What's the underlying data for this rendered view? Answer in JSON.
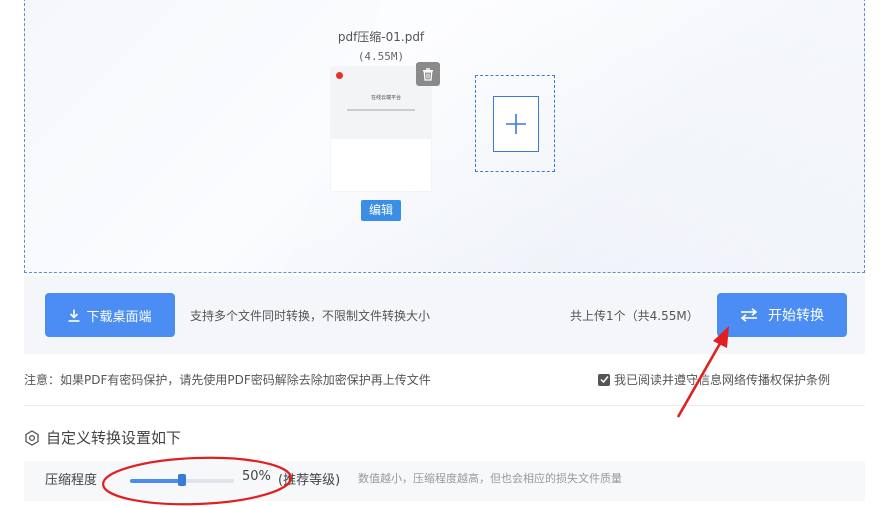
{
  "file": {
    "name": "pdf压缩-01.pdf",
    "size": "(4.55M)",
    "preview_title": "在线云端平台",
    "edit_label": "编辑"
  },
  "toolbar": {
    "download_label": "下载桌面端",
    "support_text": "支持多个文件同时转换，不限制文件转换大小",
    "upload_count": "共上传1个（共4.55M）",
    "start_label": "开始转换"
  },
  "notice": {
    "text": "注意：如果PDF有密码保护，请先使用PDF密码解除去除加密保护再上传文件",
    "agree_text": "我已阅读并遵守信息网络传播权保护条例",
    "agree_checked": true
  },
  "settings": {
    "title": "自定义转换设置如下",
    "compress_label": "压缩程度",
    "compress_percent": 50,
    "compress_value": "50%",
    "level_label": "(推荐等级)",
    "hint": "数值越小，压缩程度越高，但也会相应的损失文件质量"
  },
  "icons": {
    "delete": "trash-icon",
    "add": "plus-icon",
    "download": "download-icon",
    "convert": "swap-arrows-icon",
    "settings": "gear-icon",
    "check": "check-icon"
  },
  "colors": {
    "primary": "#4b8df2",
    "annotation": "#e02020"
  }
}
